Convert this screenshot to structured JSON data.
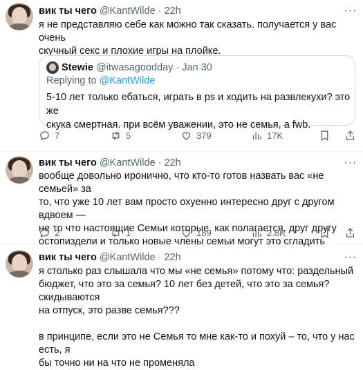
{
  "tweets": [
    {
      "author": "вик ты чего",
      "handle": "@KantWilde",
      "time": "22h",
      "text": "я не представляю себе как можно так сказать. получается у вас очень\nскучный секс и плохие игры на плойке.",
      "quote": {
        "author": "Stewie",
        "handle": "@itwasagoodday",
        "time": "Jan 30",
        "replying_prefix": "Replying to ",
        "replying_handle": "@KantWilde",
        "text": "5-10 лет только ебаться, играть в ps и ходить на развлекухи? это же\nскука смертная. при всём уважении, это не семья, а fwb."
      },
      "replies": "7",
      "retweets": "5",
      "likes": "379",
      "views": "17K"
    },
    {
      "author": "вик ты чего",
      "handle": "@KantWilde",
      "time": "22h",
      "text": "вообще довольно иронично, что кто-то готов назвать вас «не семьей» за\nто, что уже 10 лет вам просто охуенно интересно друг с другом вдвоем —\nне то что настоящие Семьи которые, как полагается, друг другу\nостопиздели и только новые члены семьи могут это сгладить",
      "replies": "2",
      "retweets": "1",
      "likes": "189",
      "views": "2.8K"
    },
    {
      "author": "вик ты чего",
      "handle": "@KantWilde",
      "time": "22h",
      "text": "я столько раз слышала что мы «не семья» потому что: раздельный\nбюджет, что это за семья? 10 лет без детей, что это за семья? скидываются\nна отпуск, это разве семья???\n\nв принципе, если это не Семья то мне как-то и похуй – то, что у нас есть, я\nбы точно ни на что не променяла"
    }
  ],
  "icons": [
    "more-icon",
    "reply-icon",
    "retweet-icon",
    "like-icon",
    "views-icon",
    "bookmark-icon",
    "share-icon"
  ],
  "colors": {
    "text": "#0f1419",
    "secondary": "#536471",
    "link": "#1d9bf0",
    "border": "#cfd9de"
  }
}
